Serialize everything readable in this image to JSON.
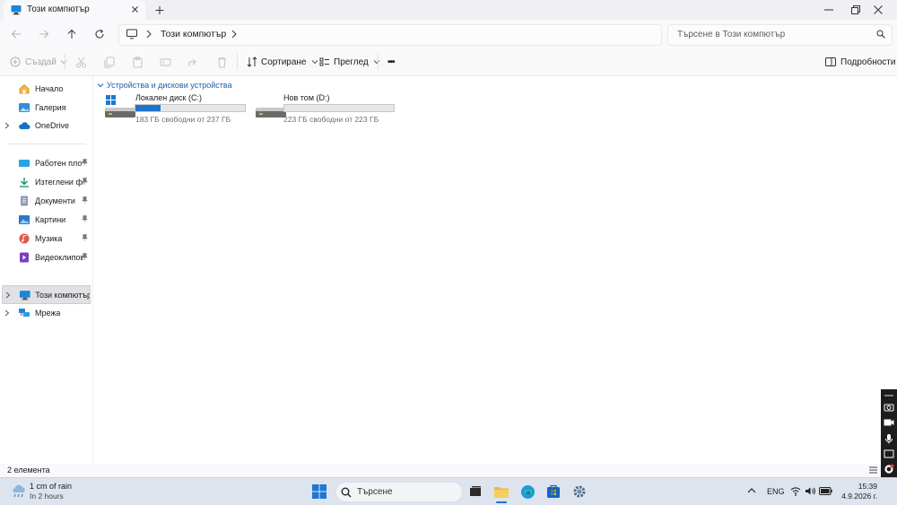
{
  "window": {
    "tab_title": "Този компютър",
    "icons": {
      "tab": "monitor-icon",
      "close_tab": "close-icon",
      "new_tab": "plus-icon",
      "minimize": "minimize-icon",
      "maximize": "maximize-icon",
      "close": "close-icon"
    }
  },
  "address": {
    "breadcrumb_root_icon": "monitor-icon",
    "crumb": "Този компютър",
    "search_placeholder": "Търсене в Този компютър"
  },
  "toolbar": {
    "new_label": "Създай",
    "sort_label": "Сортиране",
    "view_label": "Преглед",
    "more_label": "•••",
    "details_label": "Подробности"
  },
  "sidebar": {
    "items": [
      {
        "label": "Начало",
        "icon": "home-icon"
      },
      {
        "label": "Галерия",
        "icon": "gallery-icon"
      },
      {
        "label": "OneDrive",
        "icon": "cloud-icon"
      },
      {
        "label": "Работен плот",
        "icon": "desktop-icon"
      },
      {
        "label": "Изтеглени файлове",
        "icon": "download-icon"
      },
      {
        "label": "Документи",
        "icon": "documents-icon"
      },
      {
        "label": "Картини",
        "icon": "pictures-icon"
      },
      {
        "label": "Музика",
        "icon": "music-icon"
      },
      {
        "label": "Видеоклипове",
        "icon": "videos-icon"
      },
      {
        "label": "Този компютър",
        "icon": "monitor-icon",
        "selected": true
      },
      {
        "label": "Мрежа",
        "icon": "network-icon"
      }
    ]
  },
  "content": {
    "group_header": "Устройства и дискови устройства",
    "drives": [
      {
        "name": "Локален диск (C:)",
        "free_text": "183 ГБ свободни от 237 ГБ",
        "used_fraction": 0.228,
        "bar_color": "#1f73c9"
      },
      {
        "name": "Нов том (D:)",
        "free_text": "223 ГБ свободни от 223 ГБ",
        "used_fraction": 0.0,
        "bar_color": "#1f73c9"
      }
    ]
  },
  "status": {
    "item_count": "2 елемента"
  },
  "taskbar": {
    "weather_title": "1 cm of rain",
    "weather_sub": "In 2 hours",
    "search_label": "Търсене",
    "language": "ENG",
    "time": "15:39",
    "date": "4.9.2026 г."
  },
  "colors": {
    "accent": "#1f73c9",
    "selection": "#e1e1e4"
  }
}
